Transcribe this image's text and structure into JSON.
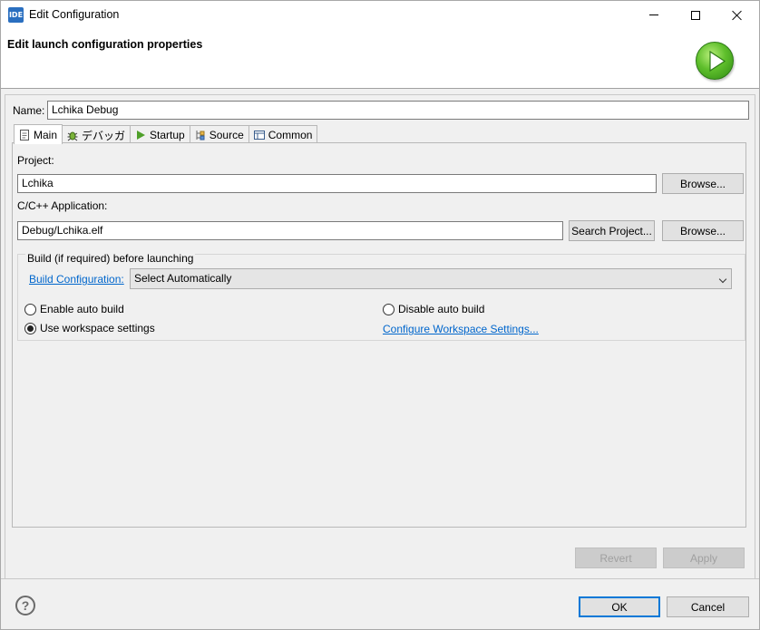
{
  "window": {
    "app_icon_text": "IDE",
    "title": "Edit Configuration"
  },
  "banner": {
    "title": "Edit launch configuration properties",
    "icon": "run-icon"
  },
  "name": {
    "label": "Name:",
    "value": "Lchika Debug"
  },
  "tabs": [
    {
      "label": "Main",
      "icon": "document-icon",
      "active": true
    },
    {
      "label": "デバッガ",
      "icon": "bug-icon",
      "active": false
    },
    {
      "label": "Startup",
      "icon": "play-icon",
      "active": false
    },
    {
      "label": "Source",
      "icon": "source-icon",
      "active": false
    },
    {
      "label": "Common",
      "icon": "common-icon",
      "active": false
    }
  ],
  "main": {
    "project_label": "Project:",
    "project_value": "Lchika",
    "browse_label": "Browse...",
    "app_label": "C/C++ Application:",
    "app_value": "Debug/Lchika.elf",
    "search_project_label": "Search Project...",
    "build_group": {
      "title": "Build (if required) before launching",
      "build_config_link": "Build Configuration:",
      "build_config_value": "Select Automatically",
      "enable_auto_build": "Enable auto build",
      "disable_auto_build": "Disable auto build",
      "use_workspace_settings": "Use workspace settings",
      "configure_workspace_link": "Configure Workspace Settings...",
      "selected": "use_workspace_settings"
    }
  },
  "actions": {
    "revert": "Revert",
    "apply": "Apply",
    "ok": "OK",
    "cancel": "Cancel"
  },
  "colors": {
    "link": "#0066cc",
    "ok_border": "#0078d7",
    "run_icon_green": "#5fbf2c"
  }
}
